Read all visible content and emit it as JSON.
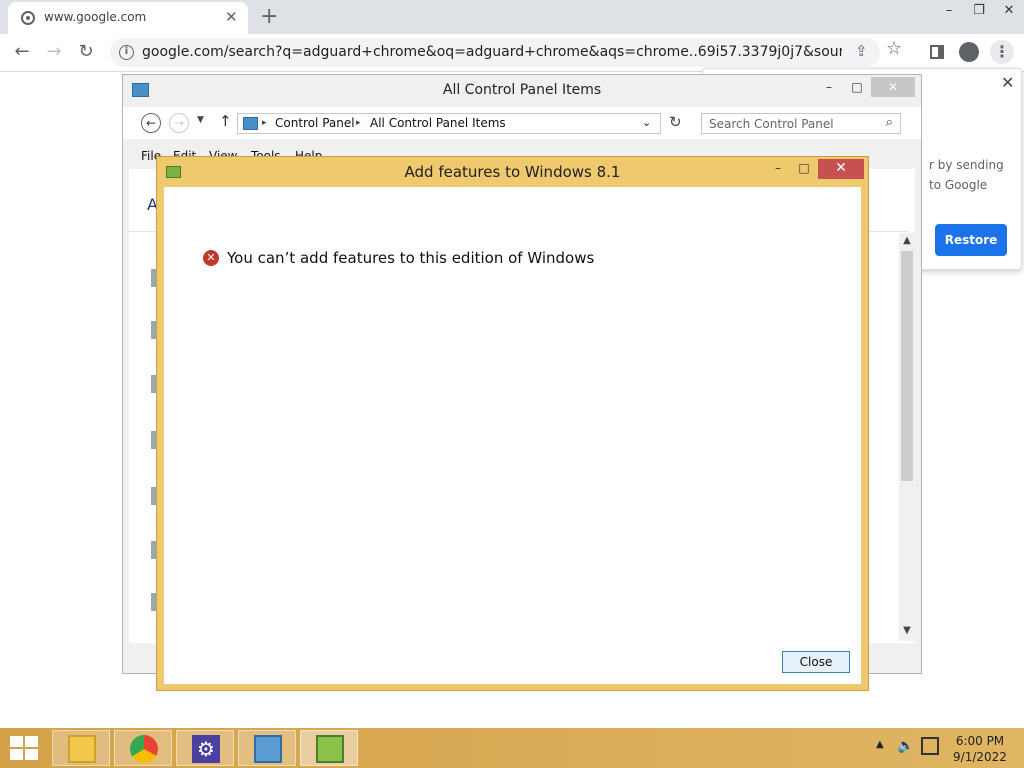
{
  "browser": {
    "tab_title": "www.google.com",
    "tab_close": "✕",
    "new_tab": "+",
    "window_controls": {
      "minimize": "–",
      "restore": "❐",
      "close": "✕"
    },
    "url": "google.com/search?q=adguard+chrome&oq=adguard+chrome&aqs=chrome..69i57.3379j0j7&sourceid=chrom...",
    "popup": {
      "text": "r by sending to Google",
      "restore_label": "Restore"
    }
  },
  "control_panel": {
    "title": "All Control Panel Items",
    "breadcrumbs": [
      "Control Panel",
      "All Control Panel Items"
    ],
    "search_placeholder": "Search Control Panel",
    "menu": [
      "File",
      "Edit",
      "View",
      "Tools",
      "Help"
    ],
    "heading_partial": "A"
  },
  "dialog": {
    "title": "Add features to Windows 8.1",
    "message": "You can’t add features to this edition of Windows",
    "close_button": "Close"
  },
  "taskbar": {
    "apps": [
      {
        "name": "File Explorer"
      },
      {
        "name": "Google Chrome"
      },
      {
        "name": "Settings"
      },
      {
        "name": "Control Panel"
      },
      {
        "name": "Add features to Windows 8.1"
      }
    ],
    "time": "6:00 PM",
    "date": "9/1/2022"
  },
  "colors": {
    "dialog_frame": "#eec96e",
    "taskbar": "#d9aa55",
    "restore_button": "#1a73e8",
    "close_button": "#c75050"
  }
}
